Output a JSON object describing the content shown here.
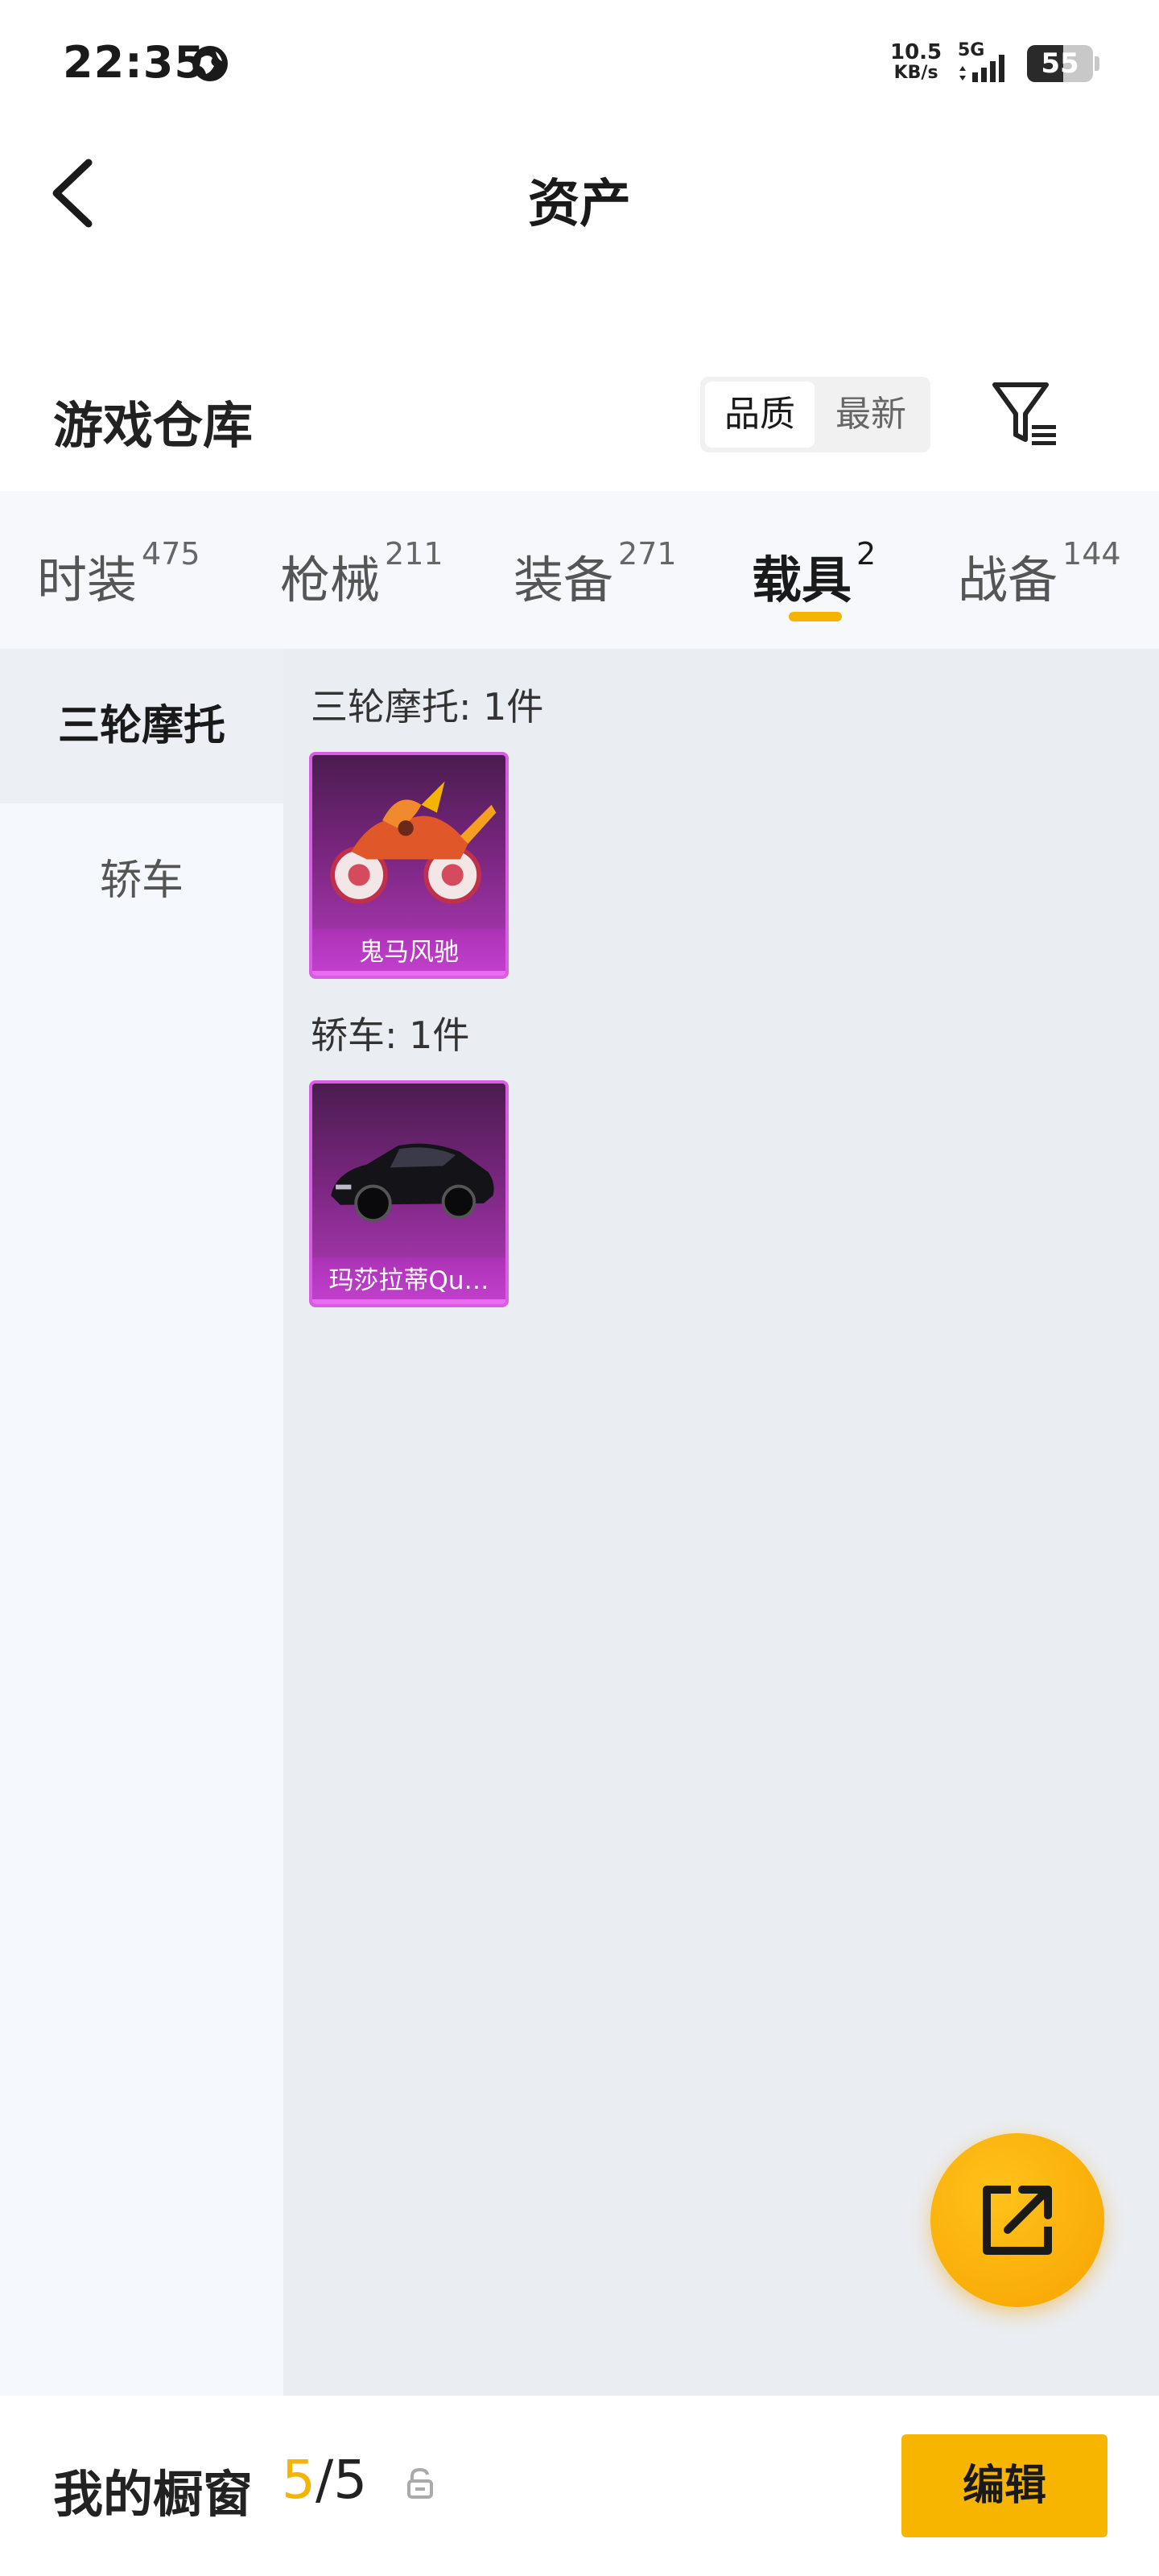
{
  "status_bar": {
    "time": "22:35",
    "net_speed_value": "10.5",
    "net_speed_unit": "KB/s",
    "network_type": "5G",
    "battery_level": "55",
    "battery_fraction": 0.55
  },
  "header": {
    "title": "资产",
    "back_icon": "chevron-left-icon"
  },
  "warehouse": {
    "title": "游戏仓库",
    "sort_options": [
      "品质",
      "最新"
    ],
    "sort_selected": "品质",
    "filter_icon": "filter-icon"
  },
  "tabs": [
    {
      "label": "时装",
      "count": "475"
    },
    {
      "label": "枪械",
      "count": "211"
    },
    {
      "label": "装备",
      "count": "271"
    },
    {
      "label": "载具",
      "count": "2"
    },
    {
      "label": "战备",
      "count": "144"
    }
  ],
  "active_tab": "载具",
  "sidebar": {
    "items": [
      {
        "label": "三轮摩托"
      },
      {
        "label": "轿车"
      }
    ],
    "selected": "三轮摩托"
  },
  "groups": [
    {
      "label": "三轮摩托: 1件",
      "items": [
        {
          "name": "鬼马风驰"
        }
      ]
    },
    {
      "label": "轿车: 1件",
      "items": [
        {
          "name": "玛莎拉蒂Qu…"
        }
      ]
    }
  ],
  "share_icon": "share-icon",
  "bottom_bar": {
    "label": "我的橱窗",
    "count_current": "5",
    "count_separator": "/",
    "count_total": "5",
    "lock_icon": "lock-icon",
    "edit_label": "编辑"
  },
  "colors": {
    "accent": "#f5b400",
    "card_purple": "#b23cbc"
  }
}
